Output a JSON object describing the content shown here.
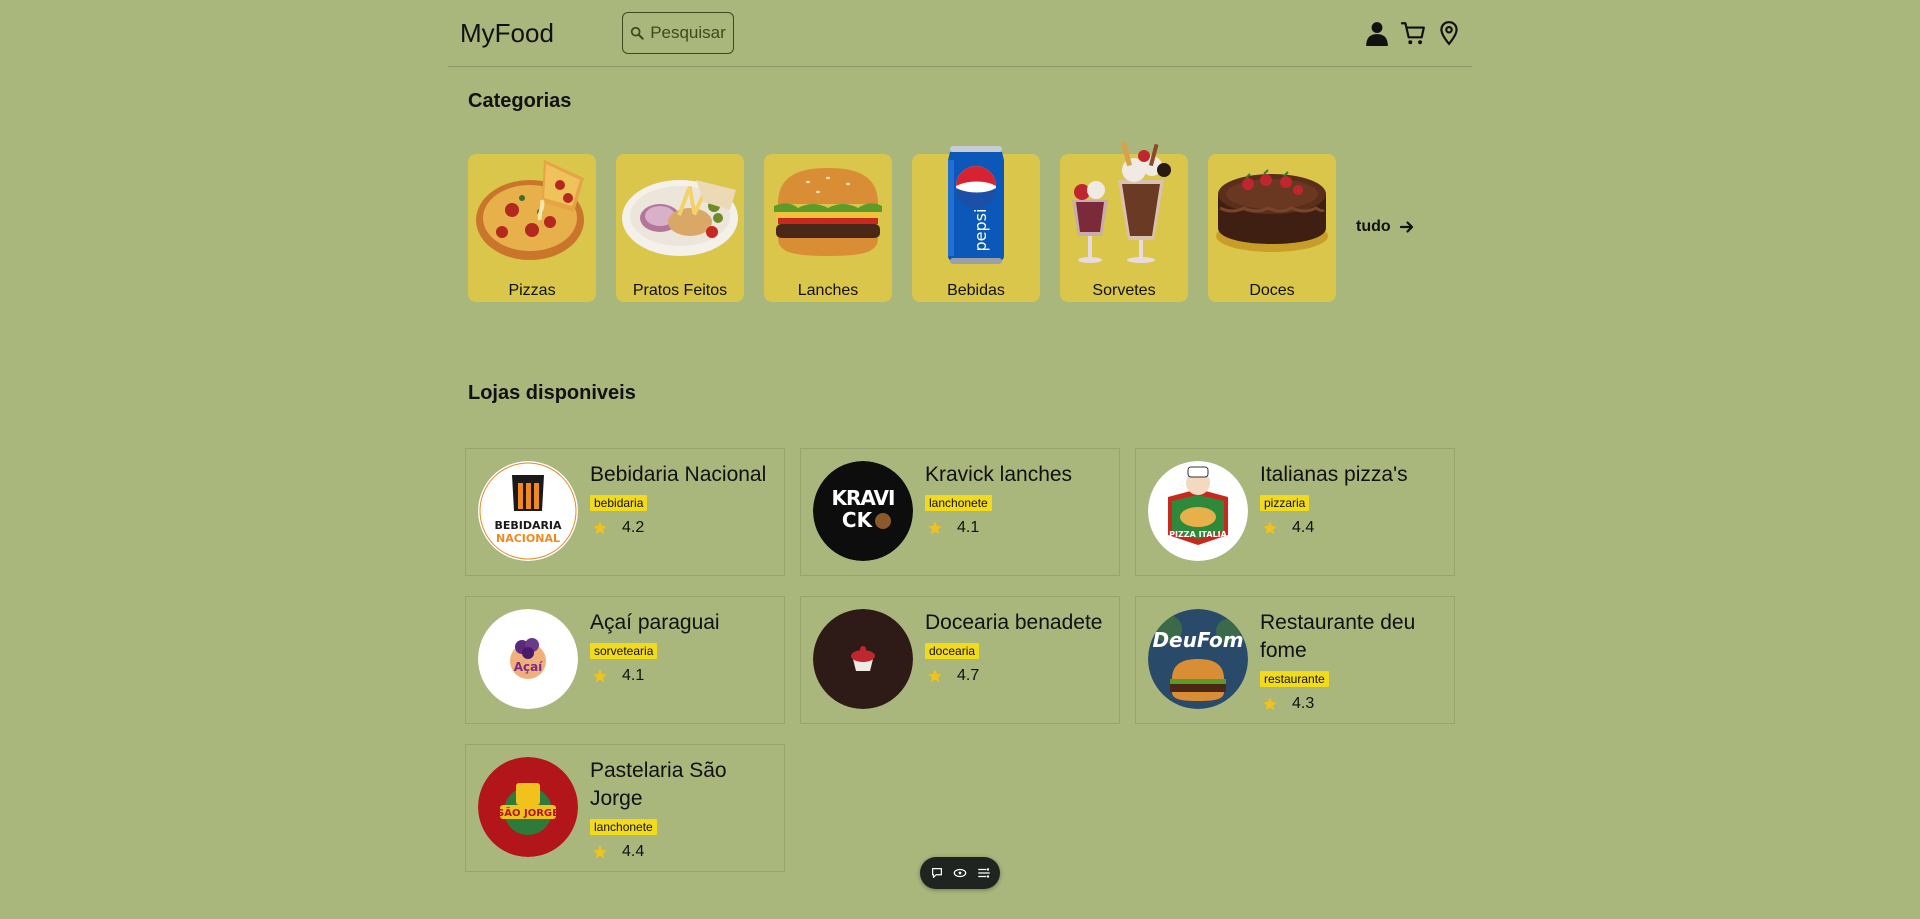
{
  "header": {
    "logo": "MyFood",
    "search_label": "Pesquisar"
  },
  "categories": {
    "title": "Categorias",
    "items": [
      {
        "label": "Pizzas",
        "icon": "pizza-image"
      },
      {
        "label": "Pratos Feitos",
        "icon": "plate-image"
      },
      {
        "label": "Lanches",
        "icon": "burger-image"
      },
      {
        "label": "Bebidas",
        "icon": "soda-can-image"
      },
      {
        "label": "Sorvetes",
        "icon": "sundae-image"
      },
      {
        "label": "Doces",
        "icon": "cake-image"
      }
    ],
    "see_all": "tudo"
  },
  "stores": {
    "title": "Lojas disponiveis",
    "items": [
      {
        "name": "Bebidaria Nacional",
        "tag": "bebidaria",
        "rating": "4.2",
        "logo_text": "BEBIDARIA NACIONAL"
      },
      {
        "name": "Kravick lanches",
        "tag": "lanchonete",
        "rating": "4.1",
        "logo_text": "KRAVICK"
      },
      {
        "name": "Italianas pizza's",
        "tag": "pizzaria",
        "rating": "4.4",
        "logo_text": "PIZZA ITALIA"
      },
      {
        "name": "Açaí paraguai",
        "tag": "sorvetearia",
        "rating": "4.1",
        "logo_text": "Açaí"
      },
      {
        "name": "Docearia benadete",
        "tag": "docearia",
        "rating": "4.7",
        "logo_text": ""
      },
      {
        "name": "Restaurante deu fome",
        "tag": "restaurante",
        "rating": "4.3",
        "logo_text": "DeuFom"
      },
      {
        "name": "Pastelaria São Jorge",
        "tag": "lanchonete",
        "rating": "4.4",
        "logo_text": "SÃO JORGE"
      }
    ]
  },
  "colors": {
    "background": "#a9b67c",
    "category_card": "#d9c64a",
    "tag": "#f2da1c",
    "star": "#f2c21c"
  }
}
